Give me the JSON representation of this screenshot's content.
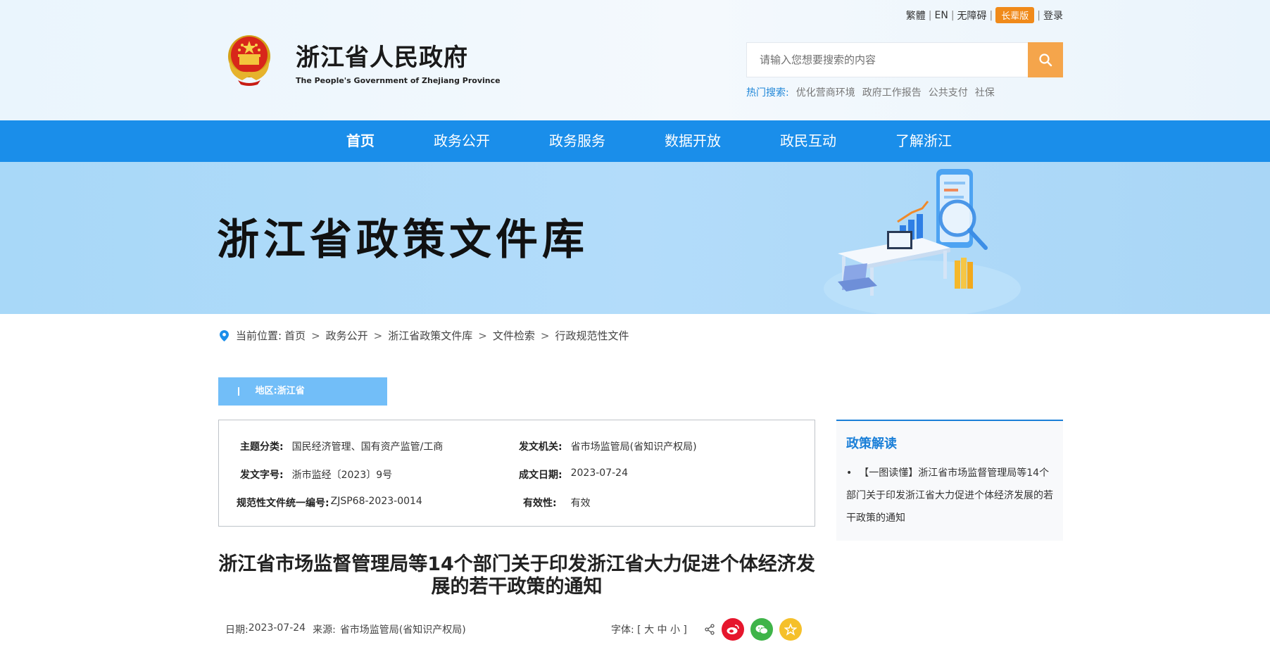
{
  "header": {
    "site_name": "浙江省人民政府",
    "site_name_en": "The People's Government of Zhejiang Province",
    "links": {
      "traditional": "繁體",
      "english": "EN",
      "accessibility": "无障碍",
      "elder": "长辈版",
      "login": "登录"
    },
    "search": {
      "placeholder": "请输入您想要搜索的内容"
    },
    "hot": {
      "label": "热门搜索:",
      "items": [
        "优化营商环境",
        "政府工作报告",
        "公共支付",
        "社保"
      ]
    }
  },
  "nav": {
    "items": [
      "首页",
      "政务公开",
      "政务服务",
      "数据开放",
      "政民互动",
      "了解浙江"
    ]
  },
  "banner": {
    "title": "浙江省政策文件库"
  },
  "breadcrumb": {
    "label": "当前位置:",
    "items": [
      "首页",
      "政务公开",
      "浙江省政策文件库",
      "文件检索",
      "行政规范性文件"
    ],
    "separator": ">"
  },
  "region": {
    "text": "地区:浙江省"
  },
  "info": {
    "topic_key": "主题分类:",
    "topic_val": "国民经济管理、国有资产监管/工商",
    "issuer_key": "发文机关:",
    "issuer_val": "省市场监管局(省知识产权局)",
    "docno_key": "发文字号:",
    "docno_val": "浙市监经〔2023〕9号",
    "date_key": "成文日期:",
    "date_val": "2023-07-24",
    "code_key": "规范性文件统一编号:",
    "code_val": "ZJSP68-2023-0014",
    "valid_key": "有效性:",
    "valid_val": "有效"
  },
  "sidebar": {
    "title": "政策解读",
    "bullet": "•",
    "item": "【一图读懂】浙江省市场监督管理局等14个部门关于印发浙江省大力促进个体经济发展的若干政策的通知"
  },
  "article": {
    "title": "浙江省市场监督管理局等14个部门关于印发浙江省大力促进个体经济发展的若干政策的通知",
    "date_label": "日期:",
    "date": "2023-07-24",
    "source_label": "来源:",
    "source": "省市场监管局(省知识产权局)",
    "font_label": "字体:",
    "font_sizes": "[ 大 中 小 ]"
  },
  "colors": {
    "nav_bg": "#1a8eea",
    "accent": "#1a7fd8",
    "elder_btn": "#f08a1a",
    "search_btn": "#f5a54b",
    "region_bg": "#72bef8",
    "weibo": "#e6162d",
    "wechat": "#3fb449",
    "favorite": "#f5c02b"
  }
}
